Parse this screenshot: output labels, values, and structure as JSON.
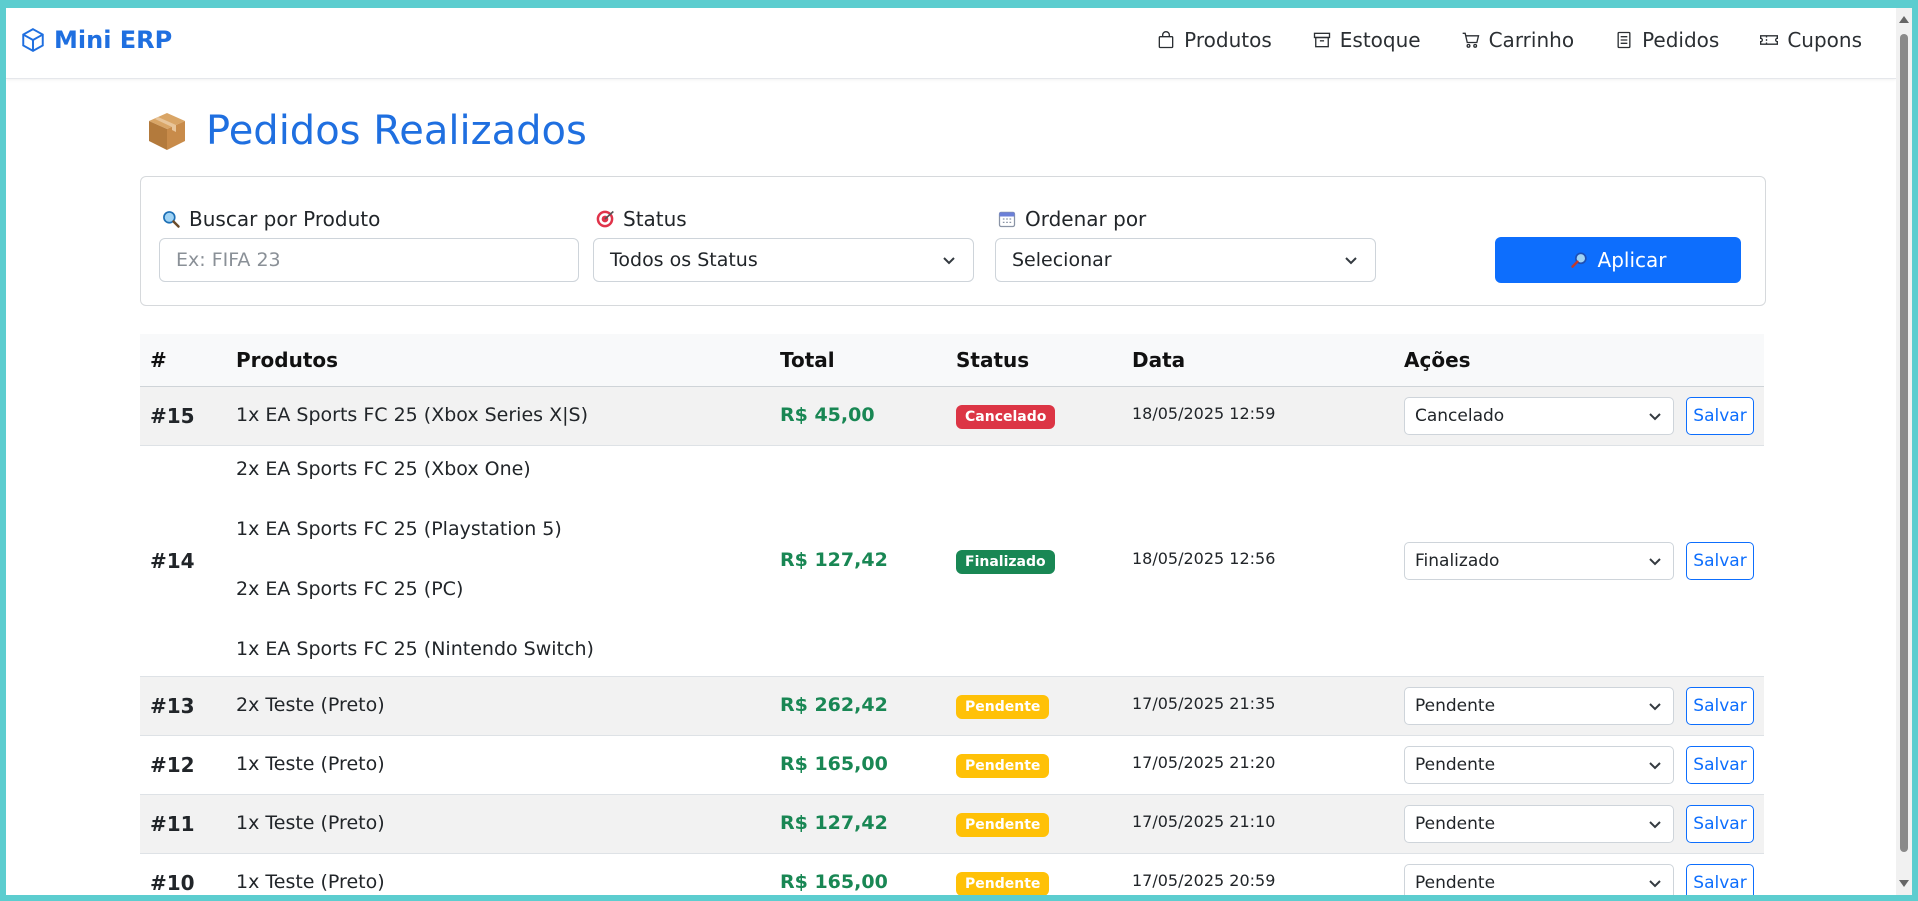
{
  "brand": "Mini ERP",
  "nav": [
    {
      "label": "Produtos",
      "icon": "bag-icon"
    },
    {
      "label": "Estoque",
      "icon": "archive-icon"
    },
    {
      "label": "Carrinho",
      "icon": "cart-icon"
    },
    {
      "label": "Pedidos",
      "icon": "list-icon"
    },
    {
      "label": "Cupons",
      "icon": "ticket-icon"
    }
  ],
  "page_title": "Pedidos Realizados",
  "filters": {
    "search_label": "Buscar por Produto",
    "search_placeholder": "Ex: FIFA 23",
    "status_label": "Status",
    "status_value": "Todos os Status",
    "order_label": "Ordenar por",
    "order_value": "Selecionar",
    "apply_label": "Aplicar"
  },
  "table": {
    "headers": [
      "#",
      "Produtos",
      "Total",
      "Status",
      "Data",
      "Ações"
    ],
    "save_label": "Salvar",
    "rows": [
      {
        "id": "#15",
        "products": [
          "1x EA Sports FC 25 (Xbox Series X|S)"
        ],
        "total": "R$ 45,00",
        "status": "Cancelado",
        "status_color": "#dc3545",
        "date": "18/05/2025 12:59",
        "action": "Cancelado"
      },
      {
        "id": "#14",
        "products": [
          "2x EA Sports FC 25 (Xbox One)",
          "1x EA Sports FC 25 (Playstation 5)",
          "2x EA Sports FC 25 (PC)",
          "1x EA Sports FC 25 (Nintendo Switch)"
        ],
        "total": "R$ 127,42",
        "status": "Finalizado",
        "status_color": "#198754",
        "date": "18/05/2025 12:56",
        "action": "Finalizado"
      },
      {
        "id": "#13",
        "products": [
          "2x Teste (Preto)"
        ],
        "total": "R$ 262,42",
        "status": "Pendente",
        "status_color": "#ffc107",
        "date": "17/05/2025 21:35",
        "action": "Pendente"
      },
      {
        "id": "#12",
        "products": [
          "1x Teste (Preto)"
        ],
        "total": "R$ 165,00",
        "status": "Pendente",
        "status_color": "#ffc107",
        "date": "17/05/2025 21:20",
        "action": "Pendente"
      },
      {
        "id": "#11",
        "products": [
          "1x Teste (Preto)"
        ],
        "total": "R$ 127,42",
        "status": "Pendente",
        "status_color": "#ffc107",
        "date": "17/05/2025 21:10",
        "action": "Pendente"
      },
      {
        "id": "#10",
        "products": [
          "1x Teste (Preto)"
        ],
        "total": "R$ 165,00",
        "status": "Pendente",
        "status_color": "#ffc107",
        "date": "17/05/2025 20:59",
        "action": "Pendente"
      }
    ]
  }
}
